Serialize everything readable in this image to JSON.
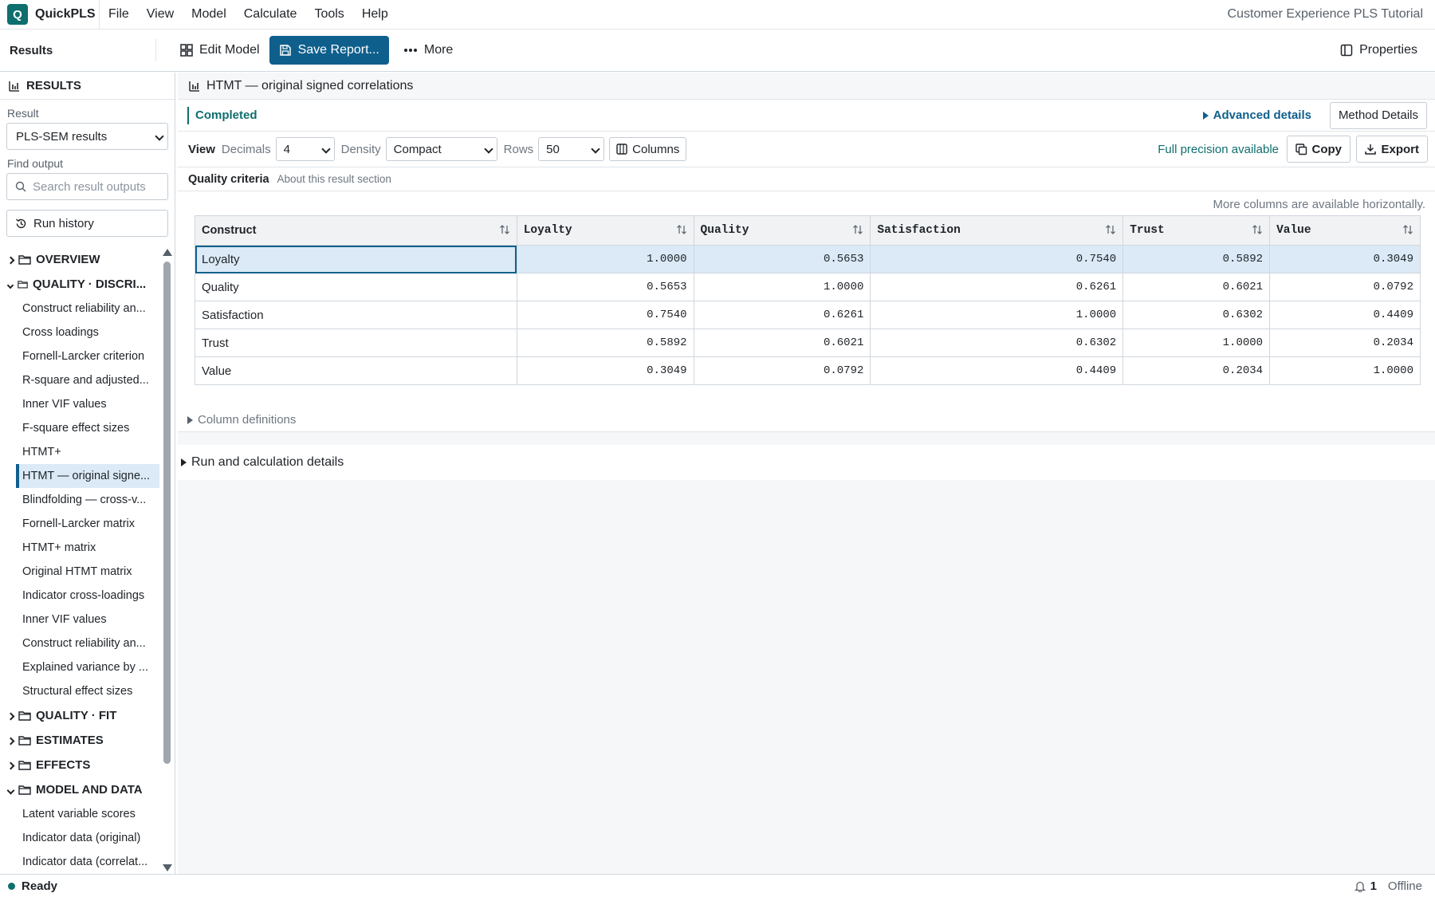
{
  "app": {
    "name": "QuickPLS",
    "logo_letter": "Q",
    "document_title": "Customer Experience PLS Tutorial"
  },
  "menu": [
    "File",
    "View",
    "Model",
    "Calculate",
    "Tools",
    "Help"
  ],
  "toolbar": {
    "title": "Results",
    "edit_model": "Edit Model",
    "save_report": "Save Report...",
    "more": "More",
    "properties": "Properties"
  },
  "sidebar": {
    "heading": "RESULTS",
    "result_label": "Result",
    "result_value": "PLS-SEM results",
    "find_label": "Find output",
    "search_placeholder": "Search result outputs",
    "run_history": "Run history",
    "groups": {
      "overview": "OVERVIEW",
      "quality_discri": "QUALITY · DISCRI...",
      "quality_fit": "QUALITY · FIT",
      "estimates": "ESTIMATES",
      "effects": "EFFECTS",
      "model_data": "MODEL AND DATA"
    },
    "quality_items": [
      "Construct reliability an...",
      "Cross loadings",
      "Fornell-Larcker criterion",
      "R-square and adjusted...",
      "Inner VIF values",
      "F-square effect sizes",
      "HTMT+",
      "HTMT — original signe...",
      "Blindfolding — cross-v...",
      "Fornell-Larcker matrix",
      "HTMT+ matrix",
      "Original HTMT matrix",
      "Indicator cross-loadings",
      "Inner VIF values",
      "Construct reliability an...",
      "Explained variance by ...",
      "Structural effect sizes"
    ],
    "model_items": [
      "Latent variable scores",
      "Indicator data (original)",
      "Indicator data (correlat..."
    ]
  },
  "panel": {
    "title": "HTMT — original signed correlations",
    "status": "Completed",
    "advanced": "Advanced details",
    "method_details": "Method Details",
    "view_label": "View",
    "decimals_label": "Decimals",
    "decimals_value": "4",
    "density_label": "Density",
    "density_value": "Compact",
    "rows_label": "Rows",
    "rows_value": "50",
    "columns_btn": "Columns",
    "full_precision": "Full precision available",
    "copy": "Copy",
    "export": "Export",
    "section_title": "Quality criteria",
    "section_sub": "About this result section",
    "more_columns": "More columns are available horizontally.",
    "column_definitions": "Column definitions",
    "run_details": "Run and calculation details"
  },
  "table": {
    "headers": [
      "Construct",
      "Loyalty",
      "Quality",
      "Satisfaction",
      "Trust",
      "Value"
    ],
    "rows": [
      [
        "Loyalty",
        "1.0000",
        "0.5653",
        "0.7540",
        "0.5892",
        "0.3049"
      ],
      [
        "Quality",
        "0.5653",
        "1.0000",
        "0.6261",
        "0.6021",
        "0.0792"
      ],
      [
        "Satisfaction",
        "0.7540",
        "0.6261",
        "1.0000",
        "0.6302",
        "0.4409"
      ],
      [
        "Trust",
        "0.5892",
        "0.6021",
        "0.6302",
        "1.0000",
        "0.2034"
      ],
      [
        "Value",
        "0.3049",
        "0.0792",
        "0.4409",
        "0.2034",
        "1.0000"
      ]
    ]
  },
  "statusbar": {
    "ready": "Ready",
    "notifications": "1",
    "connection": "Offline"
  },
  "colors": {
    "accent": "#0f5f8c",
    "teal": "#0f6e6e",
    "selection": "#dbeaf6"
  }
}
